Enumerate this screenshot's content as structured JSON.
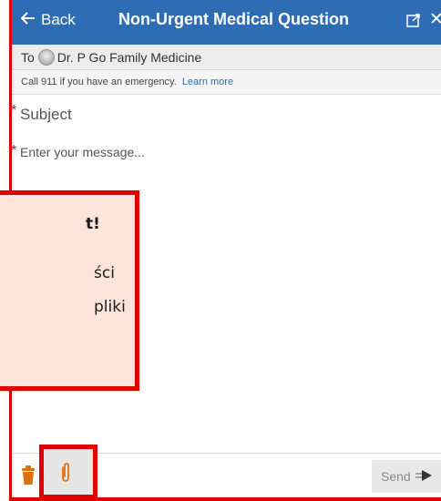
{
  "header": {
    "back_label": "Back",
    "title": "Non-Urgent Medical Question",
    "bg_color": "#2e6cb3"
  },
  "recipient": {
    "to_label": "To",
    "name": "Dr. P Go Family Medicine"
  },
  "emergency": {
    "text": "Call 911 if you have an emergency.",
    "link": "Learn more"
  },
  "form": {
    "subject_placeholder": "Subject",
    "message_placeholder": "Enter your message..."
  },
  "callout": {
    "title": "t!",
    "line1": "ści",
    "line2": "pliki",
    "highlight_color": "#e00000"
  },
  "toolbar": {
    "send_label": "Send"
  },
  "icons": {
    "back": "arrow-left-icon",
    "popout": "popout-icon",
    "close": "close-icon",
    "avatar": "avatar",
    "trash": "trash-icon",
    "attach": "paperclip-icon",
    "send": "arrow-right-icon"
  }
}
